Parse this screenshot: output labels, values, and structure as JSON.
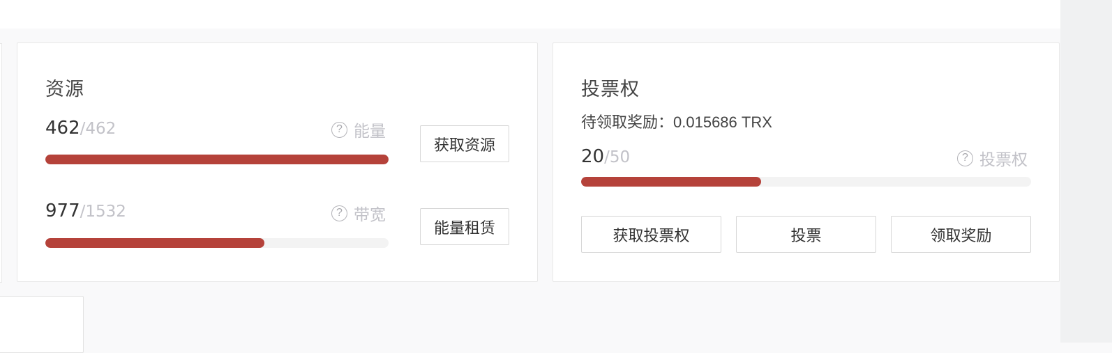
{
  "resources": {
    "title": "资源",
    "energy": {
      "used": "462",
      "total": "/462",
      "label": "能量",
      "help_icon": "question-circle-icon",
      "fraction": 1.0
    },
    "bandwidth": {
      "used": "977",
      "total": "/1532",
      "label": "带宽",
      "help_icon": "question-circle-icon",
      "fraction": 0.638
    },
    "get_resources_label": "获取资源",
    "energy_rent_label": "能量租赁"
  },
  "voting": {
    "title": "投票权",
    "reward_label": "待领取奖励：",
    "reward_value": "0.015686 TRX",
    "used": "20",
    "total": "/50",
    "label": "投票权",
    "help_icon": "question-circle-icon",
    "fraction": 0.4,
    "buttons": {
      "get_votes": "获取投票权",
      "vote": "投票",
      "claim_reward": "领取奖励"
    }
  },
  "colors": {
    "progress_fill": "#b5423a",
    "progress_track": "#f3f3f3",
    "muted_text": "#c2c2c8"
  }
}
